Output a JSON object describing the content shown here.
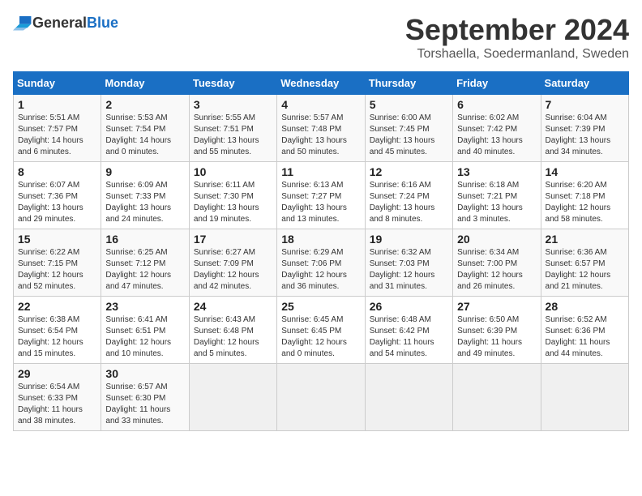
{
  "header": {
    "logo_general": "General",
    "logo_blue": "Blue",
    "month_title": "September 2024",
    "location": "Torshaella, Soedermanland, Sweden"
  },
  "weekdays": [
    "Sunday",
    "Monday",
    "Tuesday",
    "Wednesday",
    "Thursday",
    "Friday",
    "Saturday"
  ],
  "weeks": [
    [
      {
        "day": "1",
        "sunrise": "Sunrise: 5:51 AM",
        "sunset": "Sunset: 7:57 PM",
        "daylight": "Daylight: 14 hours and 6 minutes."
      },
      {
        "day": "2",
        "sunrise": "Sunrise: 5:53 AM",
        "sunset": "Sunset: 7:54 PM",
        "daylight": "Daylight: 14 hours and 0 minutes."
      },
      {
        "day": "3",
        "sunrise": "Sunrise: 5:55 AM",
        "sunset": "Sunset: 7:51 PM",
        "daylight": "Daylight: 13 hours and 55 minutes."
      },
      {
        "day": "4",
        "sunrise": "Sunrise: 5:57 AM",
        "sunset": "Sunset: 7:48 PM",
        "daylight": "Daylight: 13 hours and 50 minutes."
      },
      {
        "day": "5",
        "sunrise": "Sunrise: 6:00 AM",
        "sunset": "Sunset: 7:45 PM",
        "daylight": "Daylight: 13 hours and 45 minutes."
      },
      {
        "day": "6",
        "sunrise": "Sunrise: 6:02 AM",
        "sunset": "Sunset: 7:42 PM",
        "daylight": "Daylight: 13 hours and 40 minutes."
      },
      {
        "day": "7",
        "sunrise": "Sunrise: 6:04 AM",
        "sunset": "Sunset: 7:39 PM",
        "daylight": "Daylight: 13 hours and 34 minutes."
      }
    ],
    [
      {
        "day": "8",
        "sunrise": "Sunrise: 6:07 AM",
        "sunset": "Sunset: 7:36 PM",
        "daylight": "Daylight: 13 hours and 29 minutes."
      },
      {
        "day": "9",
        "sunrise": "Sunrise: 6:09 AM",
        "sunset": "Sunset: 7:33 PM",
        "daylight": "Daylight: 13 hours and 24 minutes."
      },
      {
        "day": "10",
        "sunrise": "Sunrise: 6:11 AM",
        "sunset": "Sunset: 7:30 PM",
        "daylight": "Daylight: 13 hours and 19 minutes."
      },
      {
        "day": "11",
        "sunrise": "Sunrise: 6:13 AM",
        "sunset": "Sunset: 7:27 PM",
        "daylight": "Daylight: 13 hours and 13 minutes."
      },
      {
        "day": "12",
        "sunrise": "Sunrise: 6:16 AM",
        "sunset": "Sunset: 7:24 PM",
        "daylight": "Daylight: 13 hours and 8 minutes."
      },
      {
        "day": "13",
        "sunrise": "Sunrise: 6:18 AM",
        "sunset": "Sunset: 7:21 PM",
        "daylight": "Daylight: 13 hours and 3 minutes."
      },
      {
        "day": "14",
        "sunrise": "Sunrise: 6:20 AM",
        "sunset": "Sunset: 7:18 PM",
        "daylight": "Daylight: 12 hours and 58 minutes."
      }
    ],
    [
      {
        "day": "15",
        "sunrise": "Sunrise: 6:22 AM",
        "sunset": "Sunset: 7:15 PM",
        "daylight": "Daylight: 12 hours and 52 minutes."
      },
      {
        "day": "16",
        "sunrise": "Sunrise: 6:25 AM",
        "sunset": "Sunset: 7:12 PM",
        "daylight": "Daylight: 12 hours and 47 minutes."
      },
      {
        "day": "17",
        "sunrise": "Sunrise: 6:27 AM",
        "sunset": "Sunset: 7:09 PM",
        "daylight": "Daylight: 12 hours and 42 minutes."
      },
      {
        "day": "18",
        "sunrise": "Sunrise: 6:29 AM",
        "sunset": "Sunset: 7:06 PM",
        "daylight": "Daylight: 12 hours and 36 minutes."
      },
      {
        "day": "19",
        "sunrise": "Sunrise: 6:32 AM",
        "sunset": "Sunset: 7:03 PM",
        "daylight": "Daylight: 12 hours and 31 minutes."
      },
      {
        "day": "20",
        "sunrise": "Sunrise: 6:34 AM",
        "sunset": "Sunset: 7:00 PM",
        "daylight": "Daylight: 12 hours and 26 minutes."
      },
      {
        "day": "21",
        "sunrise": "Sunrise: 6:36 AM",
        "sunset": "Sunset: 6:57 PM",
        "daylight": "Daylight: 12 hours and 21 minutes."
      }
    ],
    [
      {
        "day": "22",
        "sunrise": "Sunrise: 6:38 AM",
        "sunset": "Sunset: 6:54 PM",
        "daylight": "Daylight: 12 hours and 15 minutes."
      },
      {
        "day": "23",
        "sunrise": "Sunrise: 6:41 AM",
        "sunset": "Sunset: 6:51 PM",
        "daylight": "Daylight: 12 hours and 10 minutes."
      },
      {
        "day": "24",
        "sunrise": "Sunrise: 6:43 AM",
        "sunset": "Sunset: 6:48 PM",
        "daylight": "Daylight: 12 hours and 5 minutes."
      },
      {
        "day": "25",
        "sunrise": "Sunrise: 6:45 AM",
        "sunset": "Sunset: 6:45 PM",
        "daylight": "Daylight: 12 hours and 0 minutes."
      },
      {
        "day": "26",
        "sunrise": "Sunrise: 6:48 AM",
        "sunset": "Sunset: 6:42 PM",
        "daylight": "Daylight: 11 hours and 54 minutes."
      },
      {
        "day": "27",
        "sunrise": "Sunrise: 6:50 AM",
        "sunset": "Sunset: 6:39 PM",
        "daylight": "Daylight: 11 hours and 49 minutes."
      },
      {
        "day": "28",
        "sunrise": "Sunrise: 6:52 AM",
        "sunset": "Sunset: 6:36 PM",
        "daylight": "Daylight: 11 hours and 44 minutes."
      }
    ],
    [
      {
        "day": "29",
        "sunrise": "Sunrise: 6:54 AM",
        "sunset": "Sunset: 6:33 PM",
        "daylight": "Daylight: 11 hours and 38 minutes."
      },
      {
        "day": "30",
        "sunrise": "Sunrise: 6:57 AM",
        "sunset": "Sunset: 6:30 PM",
        "daylight": "Daylight: 11 hours and 33 minutes."
      },
      null,
      null,
      null,
      null,
      null
    ]
  ]
}
